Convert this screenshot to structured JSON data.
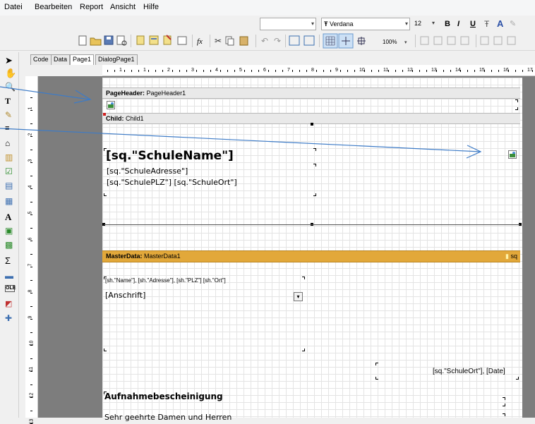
{
  "menu": [
    "Datei",
    "Bearbeiten",
    "Report",
    "Ansicht",
    "Hilfe"
  ],
  "toolbar": {
    "font_name": "Verdana",
    "font_size": "12",
    "bold": "B",
    "italic": "I",
    "underline": "U",
    "zoom": "100%"
  },
  "tabs": [
    "Code",
    "Data",
    "Page1",
    "DialogPage1"
  ],
  "ruler_h": [
    "1",
    "1",
    "2",
    "3",
    "4",
    "5",
    "6",
    "7",
    "8",
    "9",
    "10",
    "11",
    "12",
    "13",
    "14",
    "15",
    "16",
    "17"
  ],
  "ruler_v": [
    "1",
    "2",
    "3",
    "4",
    "5",
    "6",
    "7",
    "8",
    "9",
    "10",
    "11",
    "12",
    "13"
  ],
  "bands": {
    "page_header": {
      "type": "PageHeader:",
      "name": "PageHeader1"
    },
    "child": {
      "type": "Child:",
      "name": "Child1"
    },
    "master": {
      "type": "MasterData:",
      "name": "MasterData1",
      "dataset": "sq"
    }
  },
  "fields": {
    "school_name": "[sq.\"SchuleName\"]",
    "school_address": "[sq.\"SchuleAdresse\"]",
    "school_zip_city": "[sq.\"SchulePLZ\"] [sq.\"SchuleOrt\"]",
    "recipient_line": "[sh.\"Name\"],  [sh.\"Adresse\"],  [sh.\"PLZ\"] [sh.\"Ort\"]",
    "salutation_combo": "[Anschrift]",
    "place_date": "[sq.\"SchuleOrt\"], [Date]",
    "title": "Aufnahmebescheinigung",
    "greeting": "Sehr geehrte Damen und Herren"
  },
  "colors": {
    "master_band": "#e2a83a",
    "annotation_arrow": "#3d7bc7"
  }
}
